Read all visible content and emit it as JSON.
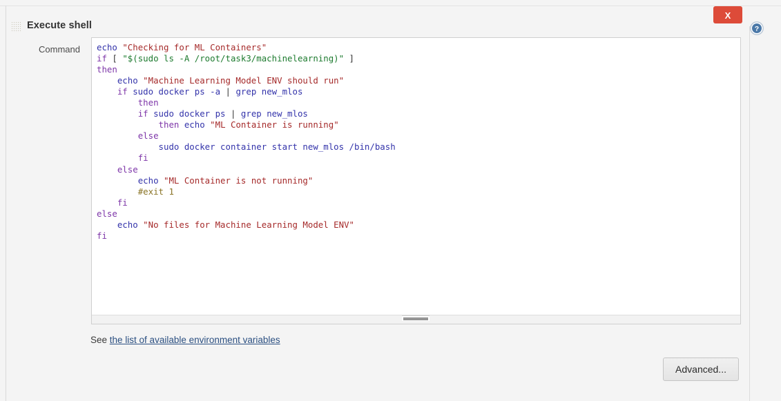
{
  "panel": {
    "title": "Execute shell",
    "drag_handle_icon": "dots-grid-icon",
    "close_label": "X",
    "help_icon": "help-circle-icon"
  },
  "form": {
    "command_label": "Command",
    "command_value": "echo \"Checking for ML Containers\"\nif [ \"$(sudo ls -A /root/task3/machinelearning)\" ]\nthen\n    echo \"Machine Learning Model ENV should run\"\n    if sudo docker ps -a | grep new_mlos\n        then\n        if sudo docker ps | grep new_mlos\n            then echo \"ML Container is running\"\n        else\n            sudo docker container start new_mlos /bin/bash\n        fi\n    else\n        echo \"ML Container is not running\"\n        #exit 1\n    fi\nelse\n    echo \"No files for Machine Learning Model ENV\"\nfi",
    "command_lines": [
      {
        "indent": 0,
        "tokens": [
          {
            "t": "echo ",
            "c": "cmd"
          },
          {
            "t": "\"Checking for ML Containers\"",
            "c": "str"
          }
        ]
      },
      {
        "indent": 0,
        "tokens": [
          {
            "t": "if",
            "c": "kw"
          },
          {
            "t": " [ ",
            "c": "pun"
          },
          {
            "t": "\"$(sudo ls -A /root/task3/machinelearning)\"",
            "c": "strg"
          },
          {
            "t": " ]",
            "c": "pun"
          }
        ]
      },
      {
        "indent": 0,
        "tokens": [
          {
            "t": "then",
            "c": "kw"
          }
        ]
      },
      {
        "indent": 4,
        "tokens": [
          {
            "t": "echo ",
            "c": "cmd"
          },
          {
            "t": "\"Machine Learning Model ENV should run\"",
            "c": "str"
          }
        ]
      },
      {
        "indent": 4,
        "tokens": [
          {
            "t": "if",
            "c": "kw"
          },
          {
            "t": " sudo docker ps -a ",
            "c": "cmd"
          },
          {
            "t": "|",
            "c": "pun"
          },
          {
            "t": " grep new_mlos",
            "c": "cmd"
          }
        ]
      },
      {
        "indent": 8,
        "tokens": [
          {
            "t": "then",
            "c": "kw"
          }
        ]
      },
      {
        "indent": 8,
        "tokens": [
          {
            "t": "if",
            "c": "kw"
          },
          {
            "t": " sudo docker ps ",
            "c": "cmd"
          },
          {
            "t": "|",
            "c": "pun"
          },
          {
            "t": " grep new_mlos",
            "c": "cmd"
          }
        ]
      },
      {
        "indent": 12,
        "tokens": [
          {
            "t": "then ",
            "c": "kw"
          },
          {
            "t": "echo ",
            "c": "cmd"
          },
          {
            "t": "\"ML Container is running\"",
            "c": "str"
          }
        ]
      },
      {
        "indent": 8,
        "tokens": [
          {
            "t": "else",
            "c": "kw"
          }
        ]
      },
      {
        "indent": 12,
        "tokens": [
          {
            "t": "sudo docker container start new_mlos /bin/bash",
            "c": "cmd"
          }
        ]
      },
      {
        "indent": 8,
        "tokens": [
          {
            "t": "fi",
            "c": "kw"
          }
        ]
      },
      {
        "indent": 4,
        "tokens": [
          {
            "t": "else",
            "c": "kw"
          }
        ]
      },
      {
        "indent": 8,
        "tokens": [
          {
            "t": "echo ",
            "c": "cmd"
          },
          {
            "t": "\"ML Container is not running\"",
            "c": "str"
          }
        ]
      },
      {
        "indent": 8,
        "tokens": [
          {
            "t": "#exit 1",
            "c": "cmt"
          }
        ]
      },
      {
        "indent": 4,
        "tokens": [
          {
            "t": "fi",
            "c": "kw"
          }
        ]
      },
      {
        "indent": 0,
        "tokens": [
          {
            "t": "else",
            "c": "kw"
          }
        ]
      },
      {
        "indent": 4,
        "tokens": [
          {
            "t": "echo ",
            "c": "cmd"
          },
          {
            "t": "\"No files for Machine Learning Model ENV\"",
            "c": "str"
          }
        ]
      },
      {
        "indent": 0,
        "tokens": [
          {
            "t": "fi",
            "c": "kw"
          }
        ]
      }
    ]
  },
  "footer": {
    "see_prefix": "See ",
    "env_link_text": "the list of available environment variables",
    "advanced_label": "Advanced..."
  },
  "colors": {
    "close_button_red": "#dd4b39",
    "help_blue": "#4a78a8",
    "link_blue": "#2b4f81",
    "keyword_purple": "#7d35a8",
    "command_blue": "#3333aa",
    "string_maroon": "#a52a2a",
    "string_green": "#1c7a2e",
    "comment_olive": "#8a7426",
    "page_background": "#f4f4f4"
  }
}
